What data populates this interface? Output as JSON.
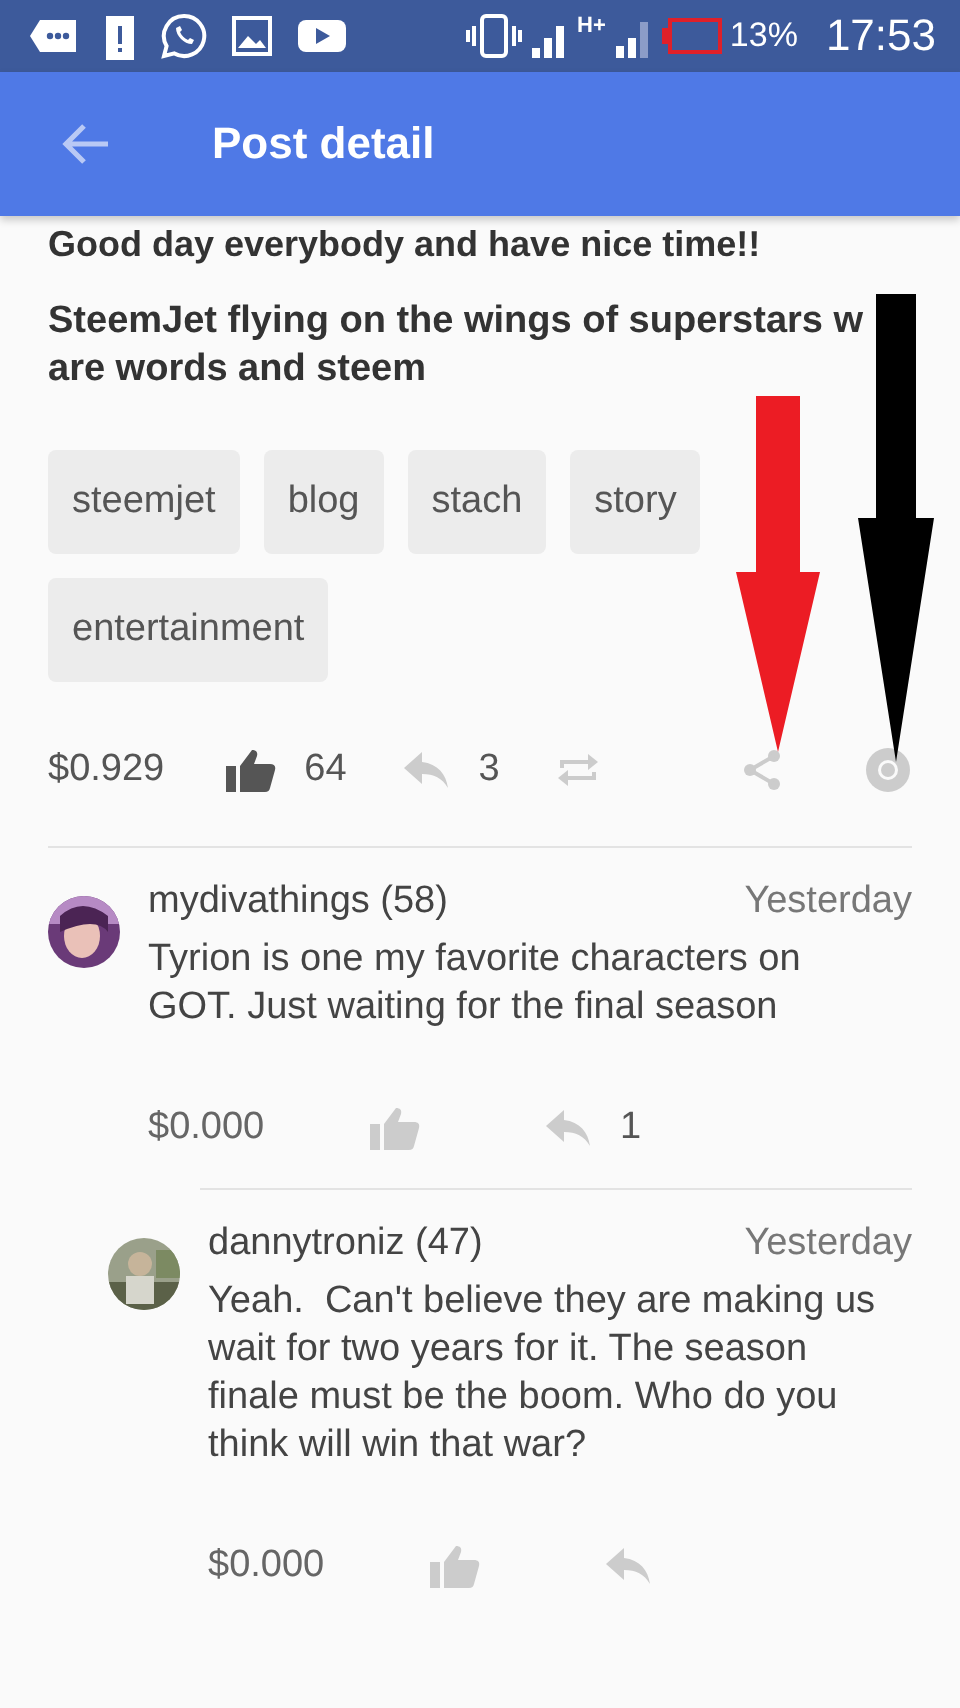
{
  "status_bar": {
    "network": "H+",
    "battery": "13%",
    "time": "17:53"
  },
  "app_bar": {
    "title": "Post detail"
  },
  "post": {
    "intro": "Good day everybody and have nice time!!",
    "headline_lines": [
      "SteemJet flying on the wings of superstars w",
      "are words and steem"
    ],
    "tags": [
      "steemjet",
      "blog",
      "stach",
      "story",
      "entertainment"
    ],
    "payout": "$0.929",
    "voted": true,
    "votes": "64",
    "replies": "3"
  },
  "comments": [
    {
      "author": "mydivathings (58)",
      "time": "Yesterday",
      "text": "Tyrion is one my favorite characters on GOT. Just waiting for the final season",
      "payout": "$0.000",
      "voted": false,
      "replies": "1",
      "children": [
        {
          "author": "dannytroniz (47)",
          "time": "Yesterday",
          "text": "Yeah.  Can't believe they are making us wait for two years for it. The season finale must be the boom. Who do you think will win that war?",
          "payout": "$0.000",
          "voted": false
        }
      ]
    }
  ]
}
